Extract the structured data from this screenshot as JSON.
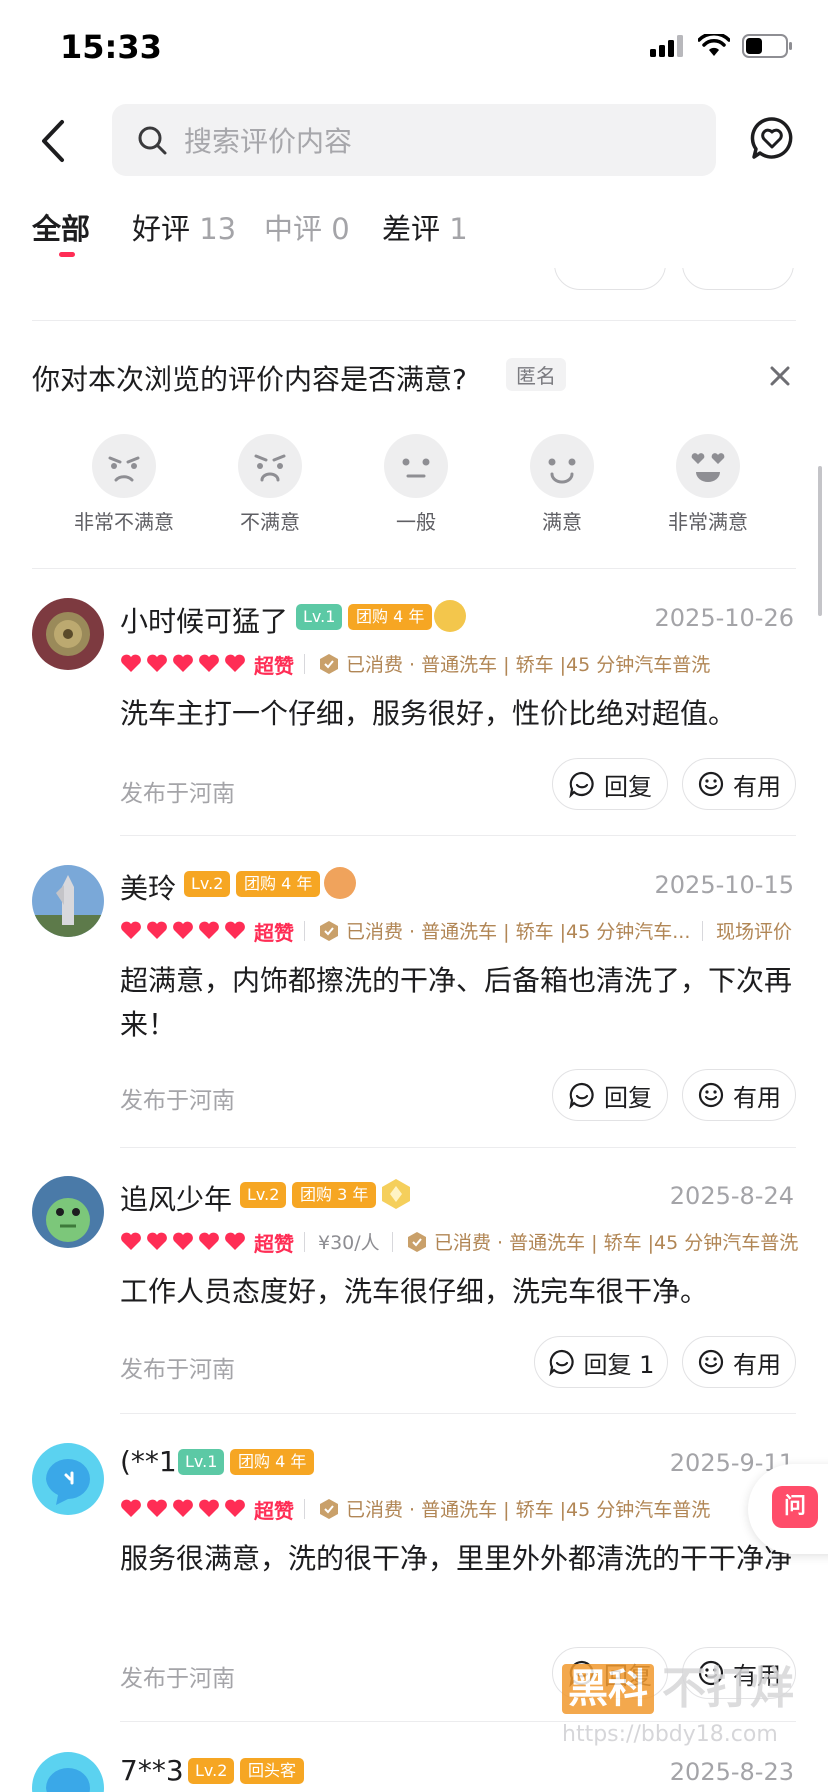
{
  "status_bar": {
    "time": "15:33"
  },
  "search": {
    "placeholder": "搜索评价内容"
  },
  "tabs": [
    {
      "label": "全部",
      "count": ""
    },
    {
      "label": "好评",
      "count": "13"
    },
    {
      "label": "中评",
      "count": "0"
    },
    {
      "label": "差评",
      "count": "1"
    }
  ],
  "survey": {
    "title": "你对本次浏览的评价内容是否满意?",
    "anon": "匿名",
    "options": [
      "非常不满意",
      "不满意",
      "一般",
      "满意",
      "非常满意"
    ]
  },
  "reviews": [
    {
      "username": "小时候可猛了",
      "level": "Lv.1",
      "tuan": "团购 4 年",
      "date": "2025-10-26",
      "rating_label": "超赞",
      "price": "",
      "consumed": "已消费 · 普通洗车 | 轿车 |45 分钟汽车普洗",
      "extra_tag": "",
      "text": "洗车主打一个仔细，服务很好，性价比绝对超值。",
      "location": "发布于河南",
      "reply_label": "回复",
      "useful_label": "有用"
    },
    {
      "username": "美玲",
      "level": "Lv.2",
      "tuan": "团购 4 年",
      "date": "2025-10-15",
      "rating_label": "超赞",
      "price": "",
      "consumed": "已消费 · 普通洗车 | 轿车 |45 分钟汽车...",
      "extra_tag": "现场评价",
      "text": "超满意，内饰都擦洗的干净、后备箱也清洗了，下次再来！",
      "location": "发布于河南",
      "reply_label": "回复",
      "useful_label": "有用"
    },
    {
      "username": "追风少年",
      "level": "Lv.2",
      "tuan": "团购 3 年",
      "date": "2025-8-24",
      "rating_label": "超赞",
      "price": "¥30/人",
      "consumed": "已消费 · 普通洗车 | 轿车 |45 分钟汽车普洗",
      "extra_tag": "",
      "text": "工作人员态度好，洗车很仔细，洗完车很干净。",
      "location": "发布于河南",
      "reply_label": "回复 1",
      "useful_label": "有用"
    },
    {
      "username": "(**1",
      "level": "Lv.1",
      "tuan": "团购 4 年",
      "date": "2025-9-11",
      "rating_label": "超赞",
      "price": "",
      "consumed": "已消费 · 普通洗车 | 轿车 |45 分钟汽车普洗",
      "extra_tag": "",
      "text": "服务很满意，洗的很干净，里里外外都清洗的干干净净",
      "location": "发布于河南",
      "reply_label": "回复",
      "useful_label": "有用"
    },
    {
      "username": "7**3",
      "level": "Lv.2",
      "tuan": "回头客",
      "date": "2025-8-23"
    }
  ],
  "float_button": {
    "label": "问"
  },
  "watermark": {
    "brand": "黑科",
    "text": "不打烊",
    "url": "https://bbdy18.com"
  },
  "colors": {
    "accent": "#ff2d55",
    "consumed": "#b18655",
    "level_green": "#5cc9a5",
    "level_orange": "#f6a623"
  }
}
